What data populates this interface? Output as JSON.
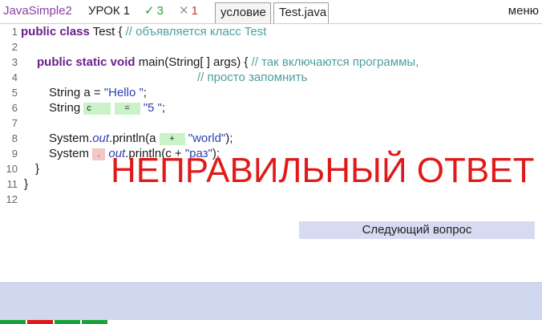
{
  "header": {
    "app_title": "JavaSimple2",
    "lesson": "УРОК 1",
    "correct_mark": "✓",
    "correct_count": "3",
    "wrong_mark": "✕",
    "wrong_count": "1",
    "tab_condition": "условие",
    "tab_file": "Test.java",
    "menu": "меню"
  },
  "code": {
    "line_numbers": [
      "1",
      "2",
      "3",
      "4",
      "5",
      "6",
      "7",
      "8",
      "9",
      "10",
      "11",
      "12"
    ],
    "l1_kw": "public class",
    "l1_name": " Test { ",
    "l1_cm": "//  объявляется класс Test",
    "l3_kw": "public static void",
    "l3_rest": " main(String[ ] args) { ",
    "l3_cm": "//  так включаются программы,",
    "l4_cm": "//  просто запомнить",
    "l5_pre": "String a = ",
    "l5_str": "\"Hello \"",
    "l5_post": ";",
    "l6_pre": "String  ",
    "l6_blank1": "c",
    "l6_blank2": "=",
    "l6_str": "\"5 \"",
    "l6_post": ";",
    "l8_pre": "System.",
    "l8_it": "out",
    "l8_mid": ".println(a  ",
    "l8_blank": "+",
    "l8_str": "\"world\"",
    "l8_post": ");",
    "l9_pre": "System ",
    "l9_blank": ".",
    "l9_it": "out",
    "l9_mid": ".println(c + ",
    "l9_str": "\"раз\"",
    "l9_post": ");",
    "l10": "}",
    "l11": "}"
  },
  "result": {
    "message": "НЕПРАВИЛЬНЫЙ ОТВЕТ",
    "color": "#e01a1a"
  },
  "next_button": "Следующий вопрос",
  "progress": [
    {
      "status": "correct",
      "color": "#1aa33a"
    },
    {
      "status": "wrong",
      "color": "#e01a1a"
    },
    {
      "status": "correct",
      "color": "#1aa33a"
    },
    {
      "status": "correct",
      "color": "#1aa33a"
    }
  ]
}
